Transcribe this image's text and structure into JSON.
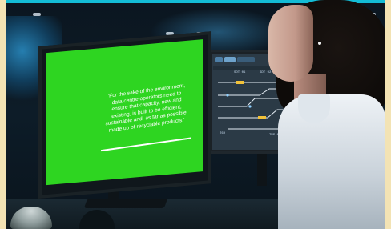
{
  "quote": {
    "lines": [
      "'For the sake of the environment,",
      "data centre operators need to",
      "ensure that capacity, new and",
      "existing, is built to be efficient,",
      "sustainable and, as far as possible,",
      "made up of recyclable products.'"
    ]
  },
  "diagram": {
    "labels": [
      "SDT 01",
      "SDT 02",
      "SDT 04",
      "SDT 05",
      "T60",
      "TRS 01",
      "TRS 03"
    ]
  },
  "colors": {
    "accent_strip": "#13bcd6",
    "green_screen": "#2ed521",
    "frame_border": "#f3e3b4"
  }
}
